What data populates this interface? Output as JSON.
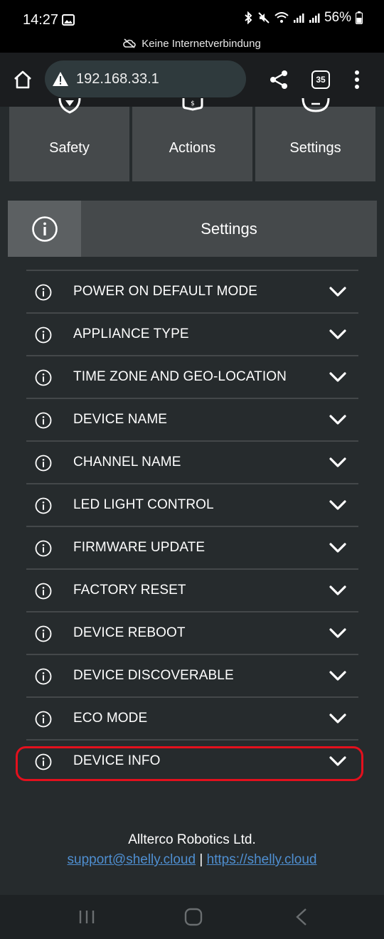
{
  "status_bar": {
    "time": "14:27",
    "battery": "56%",
    "icons": [
      "image-icon",
      "bluetooth-icon",
      "mute-icon",
      "wifi-icon",
      "signal-icon",
      "signal-icon",
      "battery-icon"
    ]
  },
  "network_banner": "Keine Internetverbindung",
  "browser": {
    "url": "192.168.33.1",
    "tab_count": "35"
  },
  "top_tiles": [
    {
      "label": "Safety"
    },
    {
      "label": "Actions"
    },
    {
      "label": "Settings"
    }
  ],
  "section": {
    "title": "Settings"
  },
  "settings_items": [
    {
      "label": "POWER ON DEFAULT MODE"
    },
    {
      "label": "APPLIANCE TYPE"
    },
    {
      "label": "TIME ZONE AND GEO-LOCATION"
    },
    {
      "label": "DEVICE NAME"
    },
    {
      "label": "CHANNEL NAME"
    },
    {
      "label": "LED LIGHT CONTROL"
    },
    {
      "label": "FIRMWARE UPDATE"
    },
    {
      "label": "FACTORY RESET"
    },
    {
      "label": "DEVICE REBOOT"
    },
    {
      "label": "DEVICE DISCOVERABLE"
    },
    {
      "label": "ECO MODE"
    },
    {
      "label": "DEVICE INFO"
    }
  ],
  "footer": {
    "company": "Allterco Robotics Ltd.",
    "support_email": "support@shelly.cloud",
    "separator": "|",
    "website": "https://shelly.cloud"
  },
  "colors": {
    "background": "#262b2d",
    "tile": "#45494b",
    "highlight": "#e3101d",
    "link": "#4f8fd1"
  }
}
